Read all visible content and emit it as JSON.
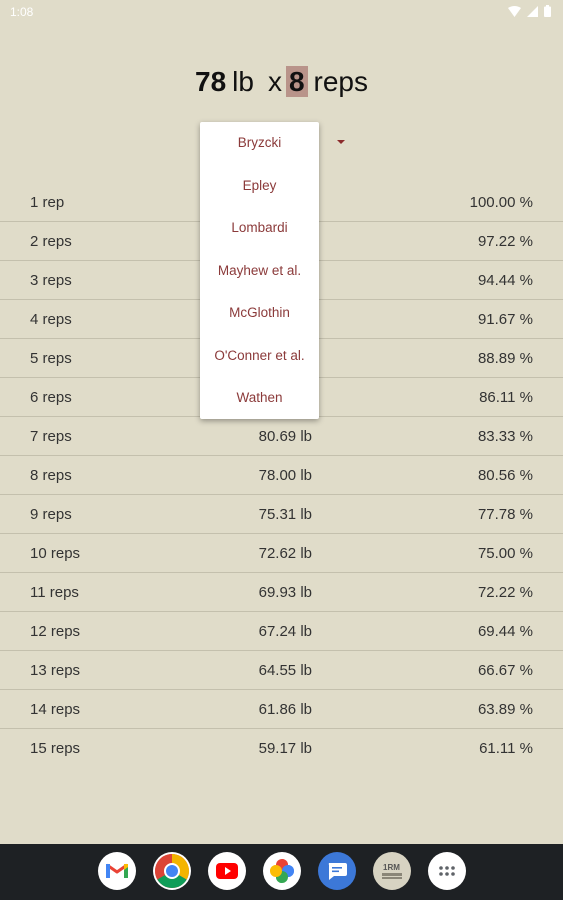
{
  "status_bar": {
    "time": "1:08"
  },
  "header": {
    "weight": "78",
    "weight_unit": "lb",
    "times": "x",
    "reps": "8",
    "reps_unit": "reps"
  },
  "formula_dropdown": {
    "options": [
      "Bryzcki",
      "Epley",
      "Lombardi",
      "Mayhew et al.",
      "McGlothin",
      "O'Conner et al.",
      "Wathen"
    ]
  },
  "table": {
    "rows": [
      {
        "reps": "1 rep",
        "weight": "",
        "percent": "100.00 %"
      },
      {
        "reps": "2 reps",
        "weight": "",
        "percent": "97.22 %"
      },
      {
        "reps": "3 reps",
        "weight": "",
        "percent": "94.44 %"
      },
      {
        "reps": "4 reps",
        "weight": "",
        "percent": "91.67 %"
      },
      {
        "reps": "5 reps",
        "weight": "",
        "percent": "88.89 %"
      },
      {
        "reps": "6 reps",
        "weight": "",
        "percent": "86.11 %"
      },
      {
        "reps": "7 reps",
        "weight": "80.69 lb",
        "percent": "83.33 %"
      },
      {
        "reps": "8 reps",
        "weight": "78.00 lb",
        "percent": "80.56 %"
      },
      {
        "reps": "9 reps",
        "weight": "75.31 lb",
        "percent": "77.78 %"
      },
      {
        "reps": "10 reps",
        "weight": "72.62 lb",
        "percent": "75.00 %"
      },
      {
        "reps": "11 reps",
        "weight": "69.93 lb",
        "percent": "72.22 %"
      },
      {
        "reps": "12 reps",
        "weight": "67.24 lb",
        "percent": "69.44 %"
      },
      {
        "reps": "13 reps",
        "weight": "64.55 lb",
        "percent": "66.67 %"
      },
      {
        "reps": "14 reps",
        "weight": "61.86 lb",
        "percent": "63.89 %"
      },
      {
        "reps": "15 reps",
        "weight": "59.17 lb",
        "percent": "61.11 %"
      }
    ]
  },
  "dock": {
    "apps": [
      "gmail-icon",
      "chrome-icon",
      "youtube-icon",
      "photos-icon",
      "messages-icon",
      "one-rep-max-app-icon",
      "app-drawer-icon"
    ],
    "one_rep_max_label": "1RM"
  },
  "colors": {
    "background": "#e0dcc9",
    "accent": "#8b3a3a",
    "reps_highlight": "#b9948a",
    "nav_bar": "#1e2124"
  }
}
